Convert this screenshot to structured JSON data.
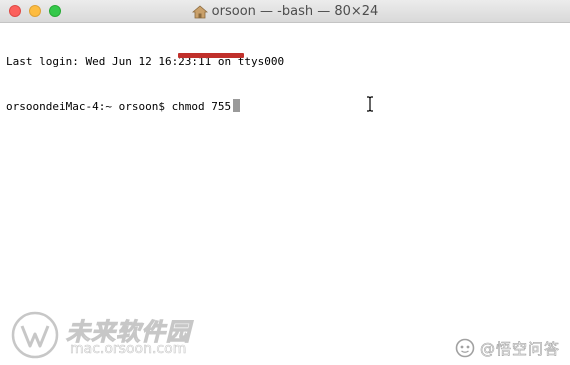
{
  "window": {
    "title": "orsoon — -bash — 80×24",
    "title_icon": "home-icon",
    "traffic_lights": {
      "close_color": "#fc605c",
      "minimize_color": "#fdbc40",
      "maximize_color": "#34c84a"
    }
  },
  "terminal": {
    "lines": [
      "Last login: Wed Jun 12 16:23:11 on ttys000",
      "orsoondeiMac-4:~ orsoon$ chmod 755"
    ],
    "cursor": "block",
    "highlight_color": "#c0302b",
    "pointer": "ibeam-cursor"
  },
  "watermarks": {
    "left_brand": "未来软件园",
    "left_url": "mac.orsoon.com",
    "right_text": "@悟空问答",
    "right_icon": "wukong-icon"
  }
}
